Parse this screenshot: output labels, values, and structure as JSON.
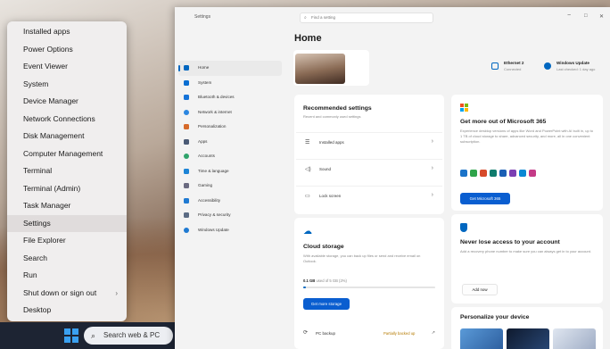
{
  "winx_menu": {
    "items": [
      {
        "label": "Installed apps"
      },
      {
        "label": "Power Options"
      },
      {
        "label": "Event Viewer"
      },
      {
        "label": "System"
      },
      {
        "label": "Device Manager"
      },
      {
        "label": "Network Connections"
      },
      {
        "label": "Disk Management"
      },
      {
        "label": "Computer Management"
      },
      {
        "label": "Terminal"
      },
      {
        "label": "Terminal (Admin)"
      },
      {
        "label": "Task Manager"
      },
      {
        "label": "Settings"
      },
      {
        "label": "File Explorer"
      },
      {
        "label": "Search"
      },
      {
        "label": "Run"
      },
      {
        "label": "Shut down or sign out",
        "chevron": "›"
      },
      {
        "label": "Desktop"
      }
    ]
  },
  "taskbar": {
    "search_placeholder": "Search web & PC",
    "search_icon": "search-icon",
    "start_icon": "windows-logo-icon"
  },
  "settings": {
    "app_title": "Settings",
    "search_placeholder": "Find a setting",
    "window_controls": {
      "minimize": "−",
      "maximize": "□",
      "close": "✕"
    },
    "page_title": "Home",
    "nav": [
      {
        "label": "Home",
        "color": "#0067c0"
      },
      {
        "label": "System",
        "color": "#0a6ed1"
      },
      {
        "label": "Bluetooth & devices",
        "color": "#1673d8"
      },
      {
        "label": "Network & internet",
        "color": "#2b86e0"
      },
      {
        "label": "Personalization",
        "color": "#d66a2a"
      },
      {
        "label": "Apps",
        "color": "#4a5a75"
      },
      {
        "label": "Accounts",
        "color": "#2fa36b"
      },
      {
        "label": "Time & language",
        "color": "#1c84d6"
      },
      {
        "label": "Gaming",
        "color": "#6a6a80"
      },
      {
        "label": "Accessibility",
        "color": "#1f7ad2"
      },
      {
        "label": "Privacy & security",
        "color": "#5b6b84"
      },
      {
        "label": "Windows Update",
        "color": "#1f7ad2"
      }
    ],
    "status": {
      "ethernet": {
        "title": "Ethernet 2",
        "subtitle": "Connected"
      },
      "update": {
        "title": "Windows Update",
        "subtitle": "Last checked: 1 day ago"
      }
    },
    "recommended": {
      "title": "Recommended settings",
      "subtitle": "Recent and commonly used settings",
      "rows": [
        {
          "icon": "installed-apps-icon",
          "glyph": "☰",
          "label": "Installed apps"
        },
        {
          "icon": "sound-icon",
          "glyph": "◁)",
          "label": "Sound"
        },
        {
          "icon": "lock-screen-icon",
          "glyph": "▭",
          "label": "Lock screen"
        }
      ],
      "chevron": "›"
    },
    "cloud": {
      "title": "Cloud storage",
      "desc": "With available storage, you can back up files or send and receive email on Outlook.",
      "usage_strong": "0.1 GB",
      "usage_rest": "used of 5 GB (2%)",
      "usage_fraction": 0.02,
      "button": "Get more storage",
      "pc_backup_label": "PC backup",
      "pc_backup_status": "Partially backed up"
    },
    "ms365": {
      "title": "Get more out of Microsoft 365",
      "desc": "Experience desktop versions of apps like Word and PowerPoint with AI built in, up to 1 TB of cloud storage to share, advanced security, and more, all in one convenient subscription.",
      "button": "Get Microsoft 365",
      "app_colors": [
        "#1a73c8",
        "#2fa34a",
        "#d64a2a",
        "#0f7b6c",
        "#1a5fb4",
        "#7b3fb3",
        "#0a88d4",
        "#c43a87"
      ]
    },
    "access": {
      "title": "Never lose access to your account",
      "desc": "Add a recovery phone number to make sure you can always get in to your account.",
      "button": "Add now"
    },
    "personalize": {
      "title": "Personalize your device",
      "wallpapers": [
        "#3f7dbd",
        "#18253a",
        "#b7c3d6"
      ]
    }
  }
}
